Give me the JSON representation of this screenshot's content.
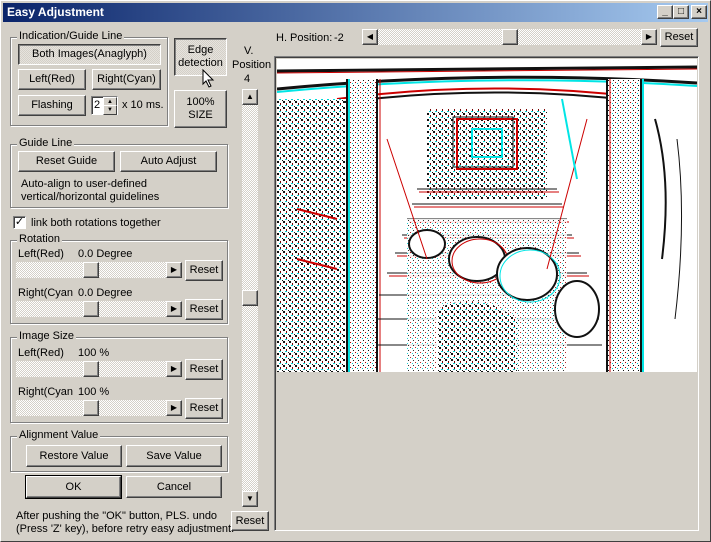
{
  "window": {
    "title": "Easy Adjustment"
  },
  "titlebar_buttons": {
    "minimize": "_",
    "maximize": "□",
    "close": "×"
  },
  "indication": {
    "group_label": "Indication/Guide Line",
    "both_images": "Both Images(Anaglyph)",
    "left_red": "Left(Red)",
    "right_cyan": "Right(Cyan)",
    "flashing": "Flashing",
    "flash_value": "2",
    "flash_unit": "x 10 ms."
  },
  "edge_detection": {
    "line1": "Edge",
    "line2": "detection"
  },
  "size_100": {
    "line1": "100%",
    "line2": "SIZE"
  },
  "v_position": {
    "label1": "V.",
    "label2": "Position",
    "value": "4",
    "thumb_fraction": 0.5
  },
  "h_position": {
    "label": "H. Position:",
    "value": "-2",
    "thumb_fraction": 0.5,
    "reset": "Reset"
  },
  "guide_line": {
    "group_label": "Guide Line",
    "reset_guide": "Reset Guide",
    "auto_adjust": "Auto Adjust",
    "desc1": "Auto-align to user-defined",
    "desc2": "vertical/horizontal guidelines"
  },
  "link_rotations": {
    "label": "link both rotations together",
    "checked": true,
    "check_mark": "✓"
  },
  "rotation": {
    "group_label": "Rotation",
    "left_label": "Left(Red)",
    "left_value": "0.0 Degree",
    "left_fraction": 0.5,
    "right_label": "Right(Cyan",
    "right_value": "0.0 Degree",
    "right_fraction": 0.5,
    "reset": "Reset"
  },
  "image_size": {
    "group_label": "Image Size",
    "left_label": "Left(Red)",
    "left_value": "100 %",
    "left_fraction": 0.5,
    "right_label": "Right(Cyan",
    "right_value": "100 %",
    "right_fraction": 0.5,
    "reset": "Reset"
  },
  "alignment": {
    "group_label": "Alignment Value",
    "restore": "Restore Value",
    "save": "Save Value"
  },
  "footer": {
    "ok": "OK",
    "cancel": "Cancel",
    "note1": "After pushing the \"OK\" button, PLS. undo",
    "note2": "(Press 'Z' key), before retry easy adjustment.",
    "v_reset": "Reset"
  },
  "arrows": {
    "left": "◀",
    "right": "▶",
    "up": "▲",
    "down": "▼"
  },
  "colors": {
    "anaglyph_red": "#cc0000",
    "anaglyph_cyan": "#00e5e5",
    "title_start": "#0a246a",
    "title_end": "#a6caf0"
  }
}
